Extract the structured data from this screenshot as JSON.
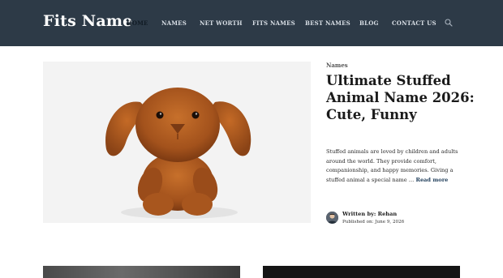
{
  "site": {
    "logo": "Fits Name"
  },
  "nav": {
    "items": [
      {
        "label": "HOME",
        "active": true
      },
      {
        "label": "NAMES"
      },
      {
        "label": "NET WORTH"
      },
      {
        "label": "FITS NAMES"
      },
      {
        "label": "BEST NAMES"
      },
      {
        "label": "BLOG"
      },
      {
        "label": "CONTACT US"
      }
    ],
    "search_icon": "search-icon"
  },
  "featured": {
    "category": "Names",
    "title": "Ultimate Stuffed Animal Name 2026: Cute, Funny",
    "excerpt": "Stuffed animals are loved by children and adults around the world. They provide comfort, companionship, and happy memories. Giving a stuffed animal a special name …",
    "read_more": "Read more",
    "author_label": "Written by: Rehan",
    "published_label": "Published on: June 9, 2026"
  },
  "colors": {
    "header_bg": "#2d3a47",
    "nav_text": "#d8dee5",
    "active_text": "#111b24"
  }
}
